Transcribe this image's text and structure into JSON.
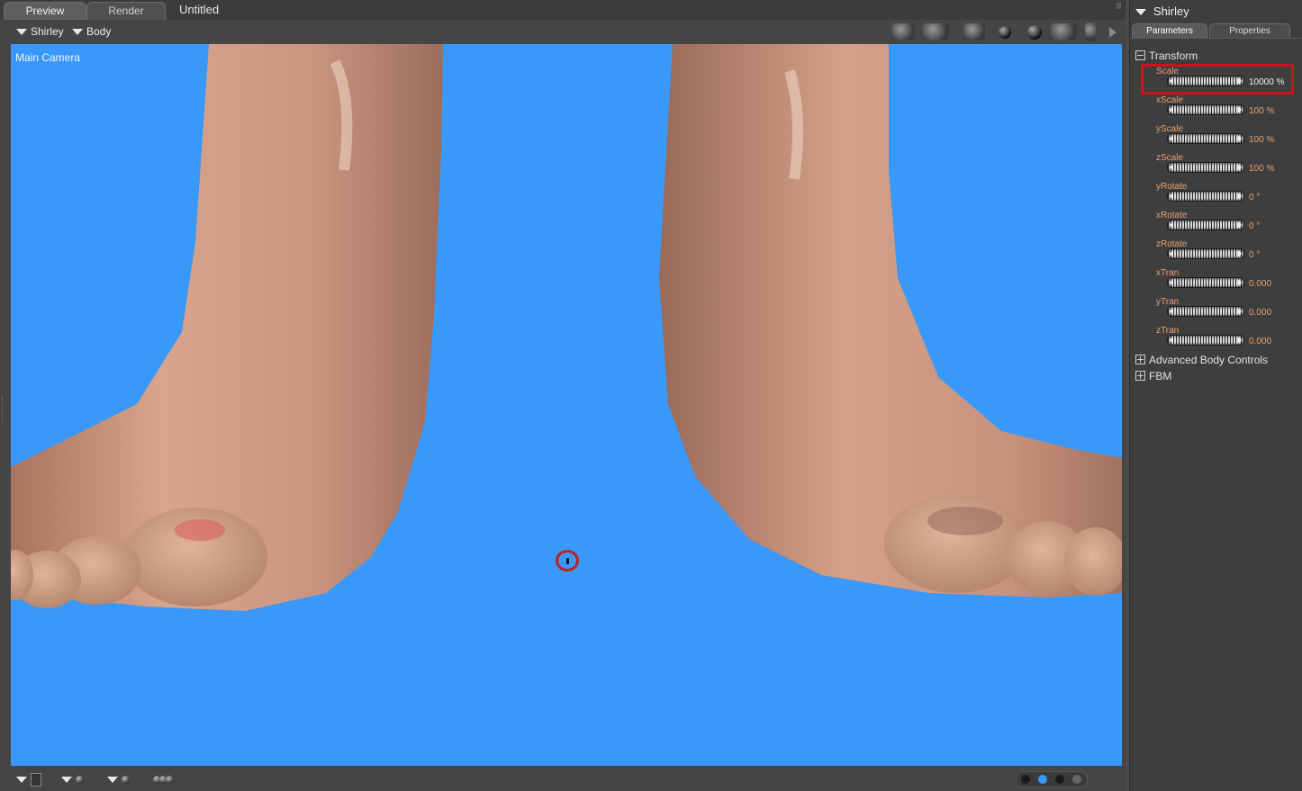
{
  "doc": {
    "tabs": [
      {
        "label": "Preview",
        "active": true
      },
      {
        "label": "Render",
        "active": false
      }
    ],
    "title": "Untitled"
  },
  "viewbar": {
    "figure_menu": "Shirley",
    "part_menu": "Body",
    "tool_icons": [
      "camera-icon",
      "camera-dolly-icon",
      "flat-shade-icon",
      "smooth-shade-icon",
      "texture-shade-icon",
      "light-icon",
      "move-icon",
      "more-icon"
    ]
  },
  "viewport": {
    "camera_label": "Main Camera",
    "background": "#3a98f9"
  },
  "bottombar": {
    "view_dots": [
      "dark",
      "selected",
      "dark",
      "dim"
    ]
  },
  "panel": {
    "title": "Shirley",
    "tabs": [
      "Parameters",
      "Properties"
    ],
    "groups": {
      "transform": "Transform",
      "advanced": "Advanced Body Controls",
      "fbm": "FBM"
    },
    "params": [
      {
        "name": "Scale",
        "value": "10000 %"
      },
      {
        "name": "xScale",
        "value": "100 %"
      },
      {
        "name": "yScale",
        "value": "100 %"
      },
      {
        "name": "zScale",
        "value": "100 %"
      },
      {
        "name": "yRotate",
        "value": "0 °"
      },
      {
        "name": "xRotate",
        "value": "0 °"
      },
      {
        "name": "zRotate",
        "value": "0 °"
      },
      {
        "name": "xTran",
        "value": "0.000"
      },
      {
        "name": "yTran",
        "value": "0.000"
      },
      {
        "name": "zTran",
        "value": "0.000"
      }
    ]
  }
}
